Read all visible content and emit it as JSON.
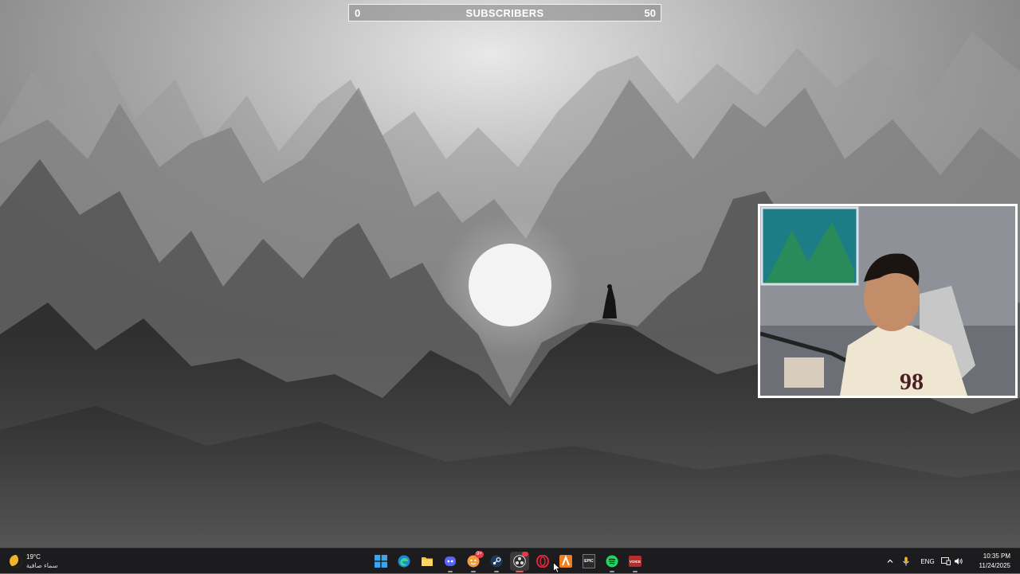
{
  "overlay": {
    "subscriber_goal": {
      "min": "0",
      "label": "SUBSCRIBERS",
      "max": "50",
      "progress": 0
    }
  },
  "wallpaper": {
    "description_icon": "mountains-moon-wallpaper"
  },
  "webcam": {
    "icon": "webcam-feed"
  },
  "taskbar": {
    "weather": {
      "temperature": "19°C",
      "condition": "سماء صافية",
      "icon": "moon-icon"
    },
    "pinned_apps": [
      {
        "name": "start",
        "icon": "windows-logo-icon",
        "running": false
      },
      {
        "name": "edge",
        "icon": "edge-icon",
        "running": false
      },
      {
        "name": "file-explorer",
        "icon": "folder-icon",
        "running": false
      },
      {
        "name": "discord",
        "icon": "discord-icon",
        "running": true
      },
      {
        "name": "chat-app",
        "icon": "chat-icon",
        "running": true,
        "badge": "9+"
      },
      {
        "name": "steam",
        "icon": "steam-icon",
        "running": true
      },
      {
        "name": "obs",
        "icon": "obs-icon",
        "running": true,
        "active": true
      },
      {
        "name": "opera",
        "icon": "opera-icon",
        "running": false
      },
      {
        "name": "app-orange",
        "icon": "orange-a-icon",
        "running": false
      },
      {
        "name": "epic-games",
        "icon": "epic-games-icon",
        "running": false,
        "label": "EPIC"
      },
      {
        "name": "spotify",
        "icon": "spotify-icon",
        "running": true
      },
      {
        "name": "voicemeeter",
        "icon": "voicemeeter-icon",
        "running": true,
        "label": "VOICE"
      }
    ],
    "tray": {
      "language": "ENG",
      "time": "10:35 PM",
      "date": "11/24/2025"
    }
  },
  "colors": {
    "taskbar_bg": "#1c1c1e",
    "accent_red": "#e05a4d"
  }
}
